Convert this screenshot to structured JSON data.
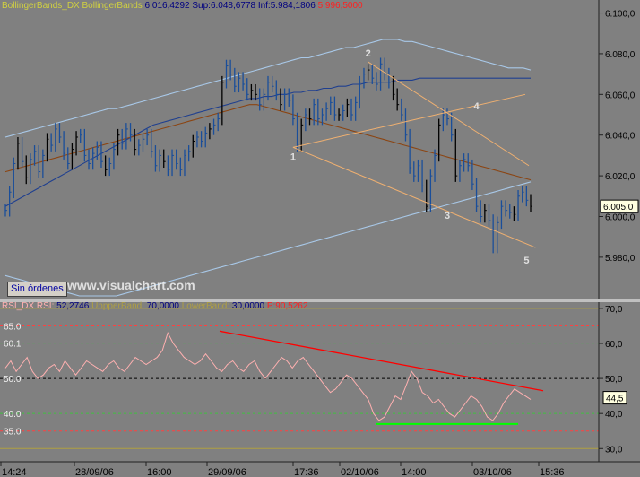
{
  "header_main": {
    "indicator": "BollingerBands_DX",
    "name": "BollingerBands",
    "value": "6.016,4292",
    "sup_label": "Sup:",
    "sup_value": "6.048,6778",
    "inf_label": "Inf:",
    "inf_value": "5.984,1806",
    "price_value": "5.996,5000"
  },
  "header_rsi": {
    "indicator": "RSI_DX",
    "name": "RSI:",
    "value": "52,2746",
    "upper_label": "UppperBand:",
    "upper_value": "70,0000",
    "lower_label": "LowerBand:",
    "lower_value": "30,0000",
    "p_label": "P:",
    "p_value": "90,5262"
  },
  "button_sin_ordenes": "Sin órdenes",
  "watermark": "www.visualchart.com",
  "colors": {
    "background": "#808080",
    "candles_blue": "#1a4e9a",
    "candles_black": "#000000",
    "bollinger_outer": "#a8c8e8",
    "bollinger_inner": "#1f3f8f",
    "moving_avg": "#8b4513",
    "channel": "#f0b070",
    "rsi_line": "#ffb0b0",
    "trend_red": "#ff0000",
    "support_green": "#00ff00"
  },
  "chart_data": [
    {
      "type": "line",
      "panel": "price",
      "y_ticks": [
        "6.100,0",
        "6.080,0",
        "6.060,0",
        "6.040,0",
        "6.020,0",
        "6.000,0",
        "5.980,0"
      ],
      "y_tick_values": [
        6100,
        6080,
        6060,
        6040,
        6020,
        6000,
        5980
      ],
      "ylim": [
        5961,
        6102
      ],
      "x_ticks": [
        "14:24",
        "28/09/06",
        "16:00",
        "29/09/06",
        "17:36",
        "02/10/06",
        "14:00",
        "03/10/06",
        "15:36"
      ],
      "last_value_label": "6.005,0",
      "last_value": 6005,
      "wave_labels": [
        {
          "label": "1",
          "x": 69,
          "y": 6034
        },
        {
          "label": "2",
          "x": 87,
          "y": 6076
        },
        {
          "label": "3",
          "x": 106,
          "y": 6005
        },
        {
          "label": "4",
          "x": 113,
          "y": 6050
        },
        {
          "label": "5",
          "x": 125,
          "y": 5983
        }
      ],
      "series": [
        {
          "values_close": [
            6003,
            6012,
            6026,
            6036,
            6027,
            6019,
            6028,
            6032,
            6022,
            6030,
            6038,
            6035,
            6043,
            6039,
            6031,
            6026,
            6033,
            6039,
            6040,
            6030,
            6026,
            6031,
            6034,
            6027,
            6023,
            6026,
            6033,
            6040,
            6036,
            6043,
            6040,
            6033,
            6035,
            6038,
            6040,
            6032,
            6025,
            6030,
            6027,
            6023,
            6030,
            6026,
            6023,
            6030,
            6032,
            6037,
            6039,
            6037,
            6041,
            6043,
            6045,
            6048,
            6066,
            6074,
            6070,
            6064,
            6068,
            6065,
            6060,
            6062,
            6060,
            6055,
            6060,
            6066,
            6064,
            6060,
            6055,
            6060,
            6057,
            6048,
            6035,
            6045,
            6050,
            6048,
            6055,
            6048,
            6050,
            6053,
            6056,
            6050,
            6050,
            6052,
            6055,
            6050,
            6056,
            6066,
            6070,
            6072,
            6068,
            6065,
            6075,
            6070,
            6066,
            6060,
            6055,
            6050,
            6040,
            6024,
            6020,
            6025,
            6015,
            6005,
            6020,
            6030,
            6045,
            6050,
            6048,
            6040,
            6020,
            6025,
            6028,
            6025,
            6016,
            6005,
            6000,
            6003,
            5998,
            5985,
            5997,
            6005,
            6003,
            6002,
            6001,
            6010,
            6012,
            6008,
            6005
          ]
        },
        {
          "name": "upper_band",
          "values": [
            6039,
            6040,
            6041,
            6042,
            6043,
            6044,
            6045,
            6046,
            6047,
            6048,
            6049,
            6050,
            6051,
            6052,
            6053,
            6053,
            6054,
            6055,
            6056,
            6057,
            6058,
            6059,
            6060,
            6061,
            6062,
            6063,
            6064,
            6065,
            6066,
            6067,
            6068,
            6069,
            6070,
            6071,
            6072,
            6073,
            6074,
            6075,
            6076,
            6077,
            6078,
            6078,
            6079,
            6080,
            6081,
            6082,
            6083,
            6083,
            6084,
            6085,
            6086,
            6087,
            6087,
            6087,
            6086,
            6086,
            6085,
            6084,
            6083,
            6082,
            6081,
            6080,
            6079,
            6078,
            6077,
            6076,
            6075,
            6074,
            6073,
            6073,
            6073,
            6072
          ]
        },
        {
          "name": "middle_band",
          "values": [
            6005,
            6007,
            6009,
            6011,
            6013,
            6015,
            6017,
            6019,
            6021,
            6023,
            6025,
            6027,
            6029,
            6031,
            6033,
            6035,
            6037,
            6039,
            6041,
            6043,
            6045,
            6046,
            6047,
            6048,
            6049,
            6050,
            6051,
            6052,
            6053,
            6054,
            6055,
            6056,
            6057,
            6058,
            6058,
            6059,
            6059,
            6060,
            6060,
            6061,
            6061,
            6062,
            6062,
            6063,
            6063,
            6064,
            6064,
            6065,
            6065,
            6066,
            6066,
            6066,
            6066,
            6067,
            6067,
            6067,
            6068,
            6068,
            6068,
            6068,
            6068,
            6068,
            6068,
            6068,
            6068,
            6068,
            6068,
            6068,
            6068,
            6068,
            6068,
            6068
          ]
        },
        {
          "name": "lower_band",
          "values": [
            5971,
            5970,
            5969,
            5968,
            5967,
            5966,
            5965,
            5964,
            5963,
            5962,
            5961,
            5961,
            5961,
            5961,
            5961,
            5961,
            5962,
            5963,
            5964,
            5965,
            5966,
            5967,
            5968,
            5969,
            5970,
            5971,
            5972,
            5973,
            5974,
            5975,
            5976,
            5977,
            5978,
            5979,
            5980,
            5981,
            5982,
            5983,
            5984,
            5985,
            5986,
            5987,
            5988,
            5989,
            5990,
            5991,
            5992,
            5993,
            5994,
            5995,
            5996,
            5997,
            5998,
            5999,
            6000,
            6001,
            6002,
            6003,
            6004,
            6005,
            6006,
            6007,
            6008,
            6009,
            6010,
            6011,
            6012,
            6013,
            6014,
            6015,
            6016,
            6017
          ]
        },
        {
          "name": "moving_average",
          "values": [
            6022,
            6023,
            6024,
            6025,
            6026,
            6027,
            6028,
            6029,
            6030,
            6031,
            6032,
            6033,
            6034,
            6035,
            6036,
            6037,
            6038,
            6039,
            6040,
            6041,
            6042,
            6043,
            6044,
            6045,
            6046,
            6047,
            6048,
            6049,
            6050,
            6051,
            6052,
            6053,
            6054,
            6055,
            6055,
            6054,
            6053,
            6052,
            6051,
            6050,
            6049,
            6048,
            6047,
            6046,
            6045,
            6044,
            6043,
            6042,
            6041,
            6040,
            6039,
            6038,
            6037,
            6036,
            6035,
            6034,
            6033,
            6032,
            6031,
            6030,
            6029,
            6028,
            6027,
            6026,
            6025,
            6024,
            6023,
            6022,
            6021,
            6020,
            6019,
            6018
          ]
        }
      ]
    },
    {
      "type": "line",
      "panel": "rsi",
      "y_ticks": [
        "70,0",
        "60,0",
        "50,0",
        "40,0",
        "30,0"
      ],
      "y_tick_values": [
        70,
        60,
        50,
        40,
        30
      ],
      "ylim": [
        27,
        71
      ],
      "left_labels": [
        "65.0",
        "60.1",
        "50.0",
        "40.0",
        "35.0"
      ],
      "left_label_values": [
        65,
        60.1,
        50,
        40,
        35
      ],
      "last_value_label": "44,5",
      "last_value": 44.5,
      "series": [
        {
          "name": "RSI",
          "values": [
            53,
            55,
            52,
            54,
            56,
            52,
            50,
            51,
            53,
            54,
            52,
            55,
            53,
            51,
            53,
            55,
            54,
            53,
            52,
            54,
            55,
            53,
            52,
            54,
            56,
            55,
            54,
            55,
            56,
            58,
            63,
            60,
            58,
            56,
            55,
            54,
            55,
            57,
            55,
            53,
            52,
            54,
            55,
            53,
            52,
            54,
            55,
            52,
            50,
            52,
            54,
            56,
            55,
            53,
            55,
            56,
            54,
            52,
            50,
            48,
            46,
            47,
            49,
            51,
            50,
            48,
            46,
            44,
            40,
            38,
            39,
            42,
            45,
            44,
            48,
            52,
            50,
            46,
            45,
            43,
            44,
            42,
            40,
            39,
            41,
            43,
            45,
            44,
            42,
            39,
            38,
            40,
            43,
            45,
            47,
            46,
            45,
            44
          ]
        }
      ]
    }
  ]
}
